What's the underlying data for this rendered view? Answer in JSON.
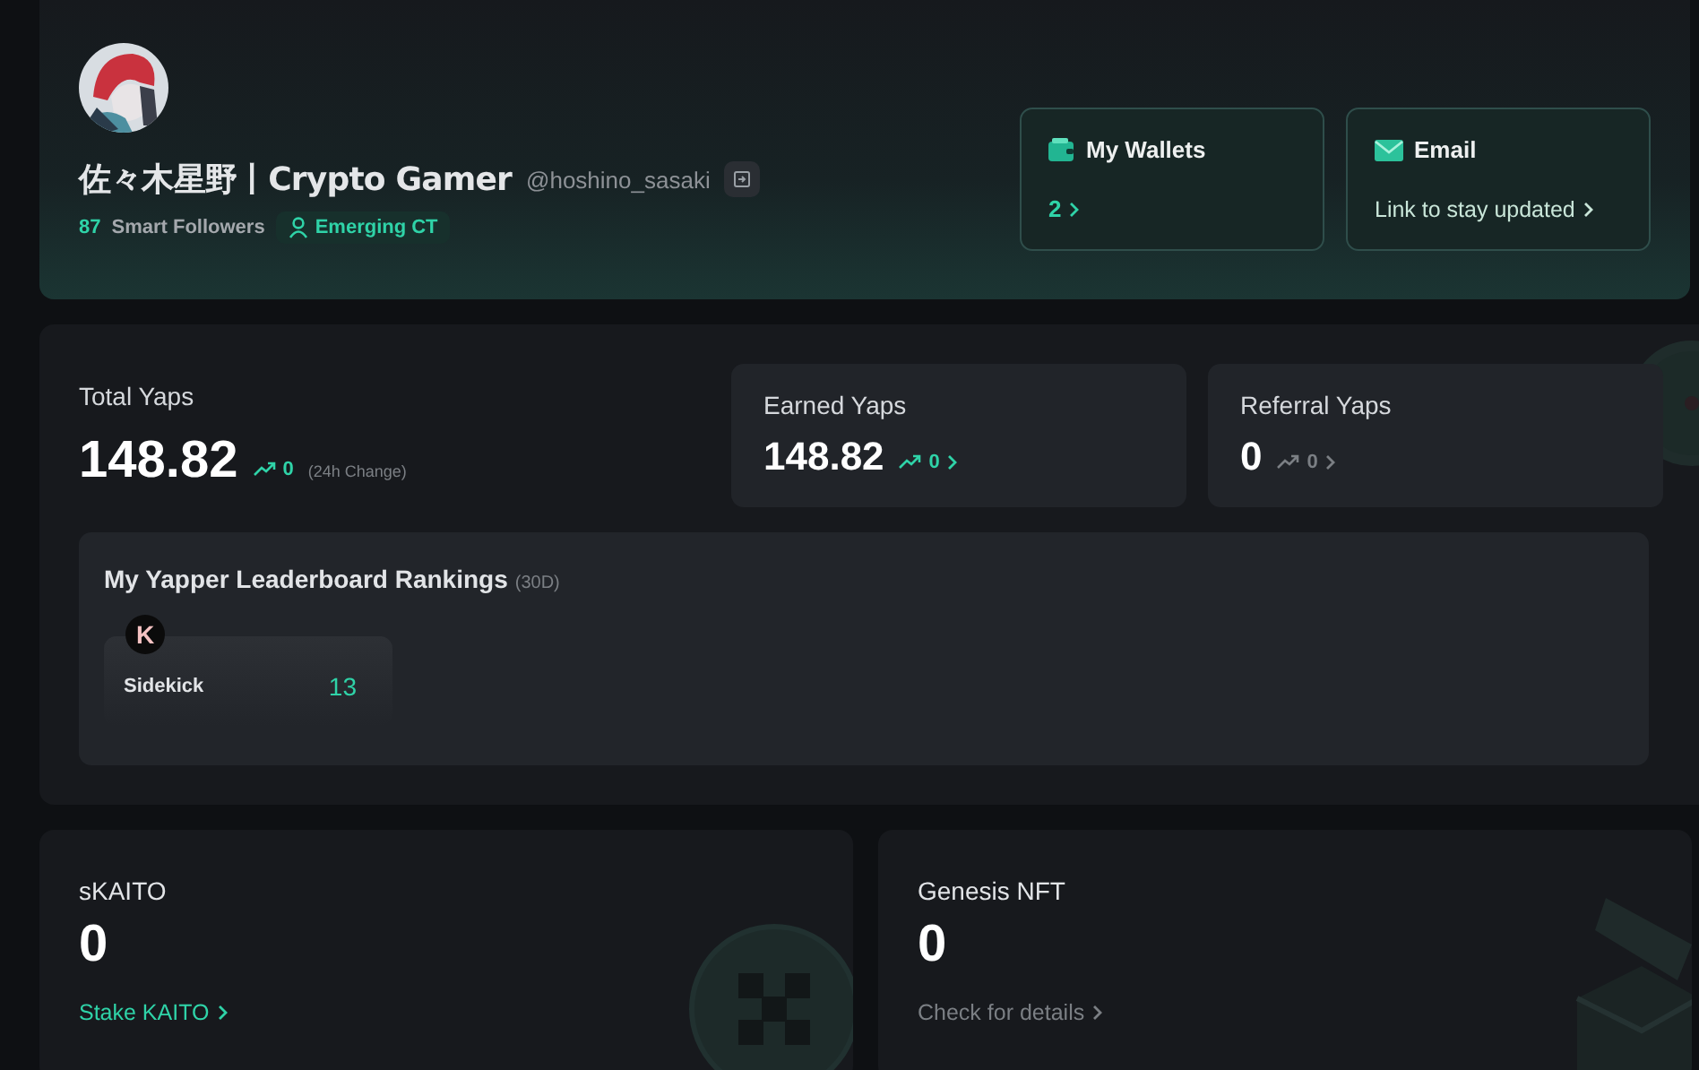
{
  "profile": {
    "name": "佐々木星野丨Crypto Gamer",
    "handle": "@hoshino_sasaki",
    "smart_followers_count": "87",
    "smart_followers_label": "Smart Followers",
    "badge": "Emerging CT"
  },
  "quick_cards": [
    {
      "kind": "wallet",
      "title": "My Wallets",
      "value": "2",
      "active": true
    },
    {
      "kind": "email",
      "title": "Email",
      "value": "Link to stay updated",
      "active": false
    }
  ],
  "total_yaps": {
    "label": "Total Yaps",
    "value": "148.82",
    "change": "0",
    "change_note": "(24h Change)"
  },
  "yap_cards": [
    {
      "label": "Earned Yaps",
      "value": "148.82",
      "change": "0",
      "active": true
    },
    {
      "label": "Referral Yaps",
      "value": "0",
      "change": "0",
      "active": false
    }
  ],
  "leaderboard": {
    "title": "My Yapper Leaderboard Rankings",
    "period": "(30D)",
    "items": [
      {
        "logo_letter": "K",
        "name": "Sidekick",
        "rank": "13"
      }
    ]
  },
  "bottom_cards": [
    {
      "kind": "coin",
      "title": "sKAITO",
      "value": "0",
      "link": "Stake KAITO",
      "active": true
    },
    {
      "kind": "box",
      "title": "Genesis NFT",
      "value": "0",
      "link": "Check for details",
      "active": false
    }
  ]
}
